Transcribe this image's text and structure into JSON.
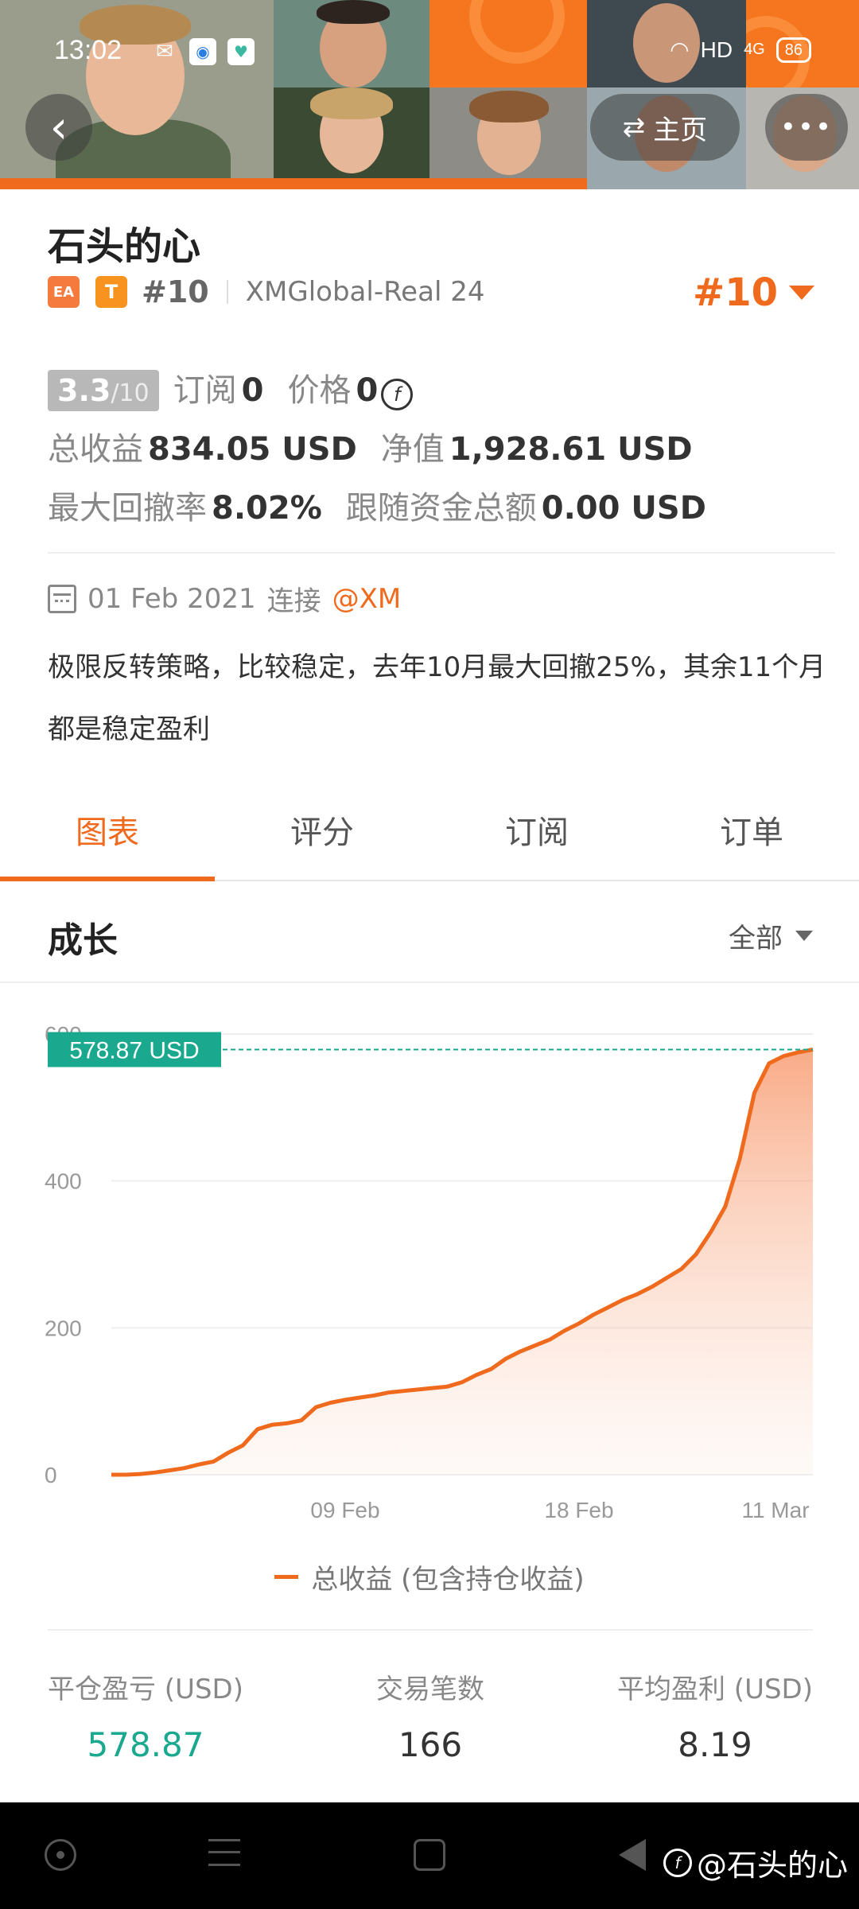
{
  "status_bar": {
    "time": "13:02",
    "network": "HD",
    "signal": "4G",
    "battery": "86"
  },
  "header": {
    "home_label": "主页",
    "more_label": "•••"
  },
  "profile": {
    "name": "石头的心",
    "badge_ea": "EA",
    "badge_t": "T",
    "rank_small": "#10",
    "server": "XMGlobal-Real 24",
    "rank_big": "#10"
  },
  "metrics": {
    "score": "3.3",
    "score_den": "/10",
    "subscribe_label": "订阅",
    "subscribe_value": "0",
    "price_label": "价格",
    "price_value": "0",
    "total_profit_label": "总收益",
    "total_profit_value": "834.05 USD",
    "net_label": "净值",
    "net_value": "1,928.61 USD",
    "max_dd_label": "最大回撤率",
    "max_dd_value": "8.02%",
    "follow_label": "跟随资金总额",
    "follow_value": "0.00 USD"
  },
  "connection": {
    "date": "01 Feb 2021",
    "connect_label": "连接",
    "broker": "@XM"
  },
  "description": "极限反转策略，比较稳定，去年10月最大回撤25%，其余11个月都是稳定盈利",
  "tabs": [
    {
      "label": "图表",
      "active": true
    },
    {
      "label": "评分",
      "active": false
    },
    {
      "label": "订阅",
      "active": false
    },
    {
      "label": "订单",
      "active": false
    }
  ],
  "section": {
    "title": "成长",
    "filter": "全部"
  },
  "chart_data": {
    "type": "area",
    "title": "",
    "xlabel": "",
    "ylabel": "",
    "ylim": [
      0,
      600
    ],
    "yticks": [
      0,
      200,
      400,
      600
    ],
    "xtick_labels": [
      "09 Feb",
      "18 Feb",
      "11 Mar"
    ],
    "current_label": "578.87 USD",
    "current_value": 578.87,
    "series": [
      {
        "name": "总收益 (包含持仓收益)",
        "color": "#f06a1d",
        "values": [
          0,
          0,
          1,
          3,
          6,
          9,
          14,
          18,
          30,
          40,
          62,
          68,
          70,
          74,
          92,
          98,
          102,
          105,
          108,
          112,
          114,
          116,
          118,
          120,
          126,
          136,
          144,
          158,
          168,
          176,
          184,
          196,
          206,
          218,
          228,
          238,
          246,
          256,
          268,
          280,
          300,
          330,
          365,
          430,
          520,
          560,
          570,
          575,
          578.87
        ]
      }
    ],
    "grid": true,
    "legend": "bottom-center"
  },
  "stats": [
    {
      "label": "平仓盈亏 (USD)",
      "value": "578.87",
      "color": "green"
    },
    {
      "label": "交易笔数",
      "value": "166",
      "color": "default"
    },
    {
      "label": "平均盈利 (USD)",
      "value": "8.19",
      "color": "default"
    }
  ],
  "watermark": "@石头的心",
  "colors": {
    "accent": "#f06a1d",
    "positive": "#1aa88e",
    "line_marker": "#1aa88e"
  }
}
